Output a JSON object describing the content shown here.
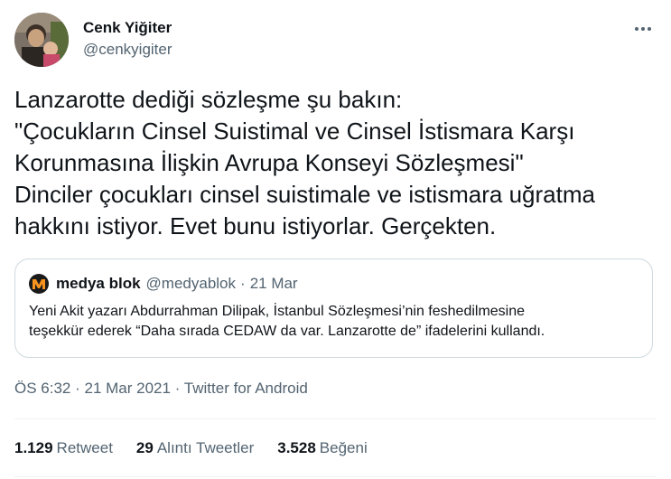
{
  "author": {
    "name": "Cenk Yiğiter",
    "handle": "@cenkyigiter"
  },
  "tweet": {
    "lines": [
      "Lanzarotte dediği sözleşme şu bakın:",
      "\"Çocukların Cinsel Suistimal ve Cinsel İstismara Karşı",
      "Korunmasına İlişkin Avrupa Konseyi Sözleşmesi\"",
      "Dinciler çocukları cinsel suistimale ve istismara uğratma",
      "hakkını istiyor. Evet bunu istiyorlar. Gerçekten."
    ]
  },
  "quote": {
    "logo_letter": "M",
    "name": "medya blok",
    "handle": "@medyablok",
    "separator": "·",
    "date": "21 Mar",
    "lines": [
      "Yeni Akit yazarı Abdurrahman Dilipak, İstanbul Sözleşmesi’nin feshedilmesine",
      "teşekkür ederek “Daha sırada CEDAW da var. Lanzarotte de” ifadelerini kullandı."
    ]
  },
  "meta": {
    "time": "ÖS 6:32",
    "separator": "·",
    "date": "21 Mar 2021",
    "source": "Twitter for Android"
  },
  "stats": {
    "retweets_count": "1.129",
    "retweets_label": "Retweet",
    "quotes_count": "29",
    "quotes_label": "Alıntı Tweetler",
    "likes_count": "3.528",
    "likes_label": "Beğeni"
  },
  "colors": {
    "primary_text": "#0f1419",
    "secondary_text": "#536471",
    "border": "#cfd9de",
    "divider": "#eff3f4",
    "logo_accent": "#f7931e"
  },
  "icons": {
    "more": "more-horizontal-icon",
    "quote_logo": "medya-blok-logo"
  }
}
